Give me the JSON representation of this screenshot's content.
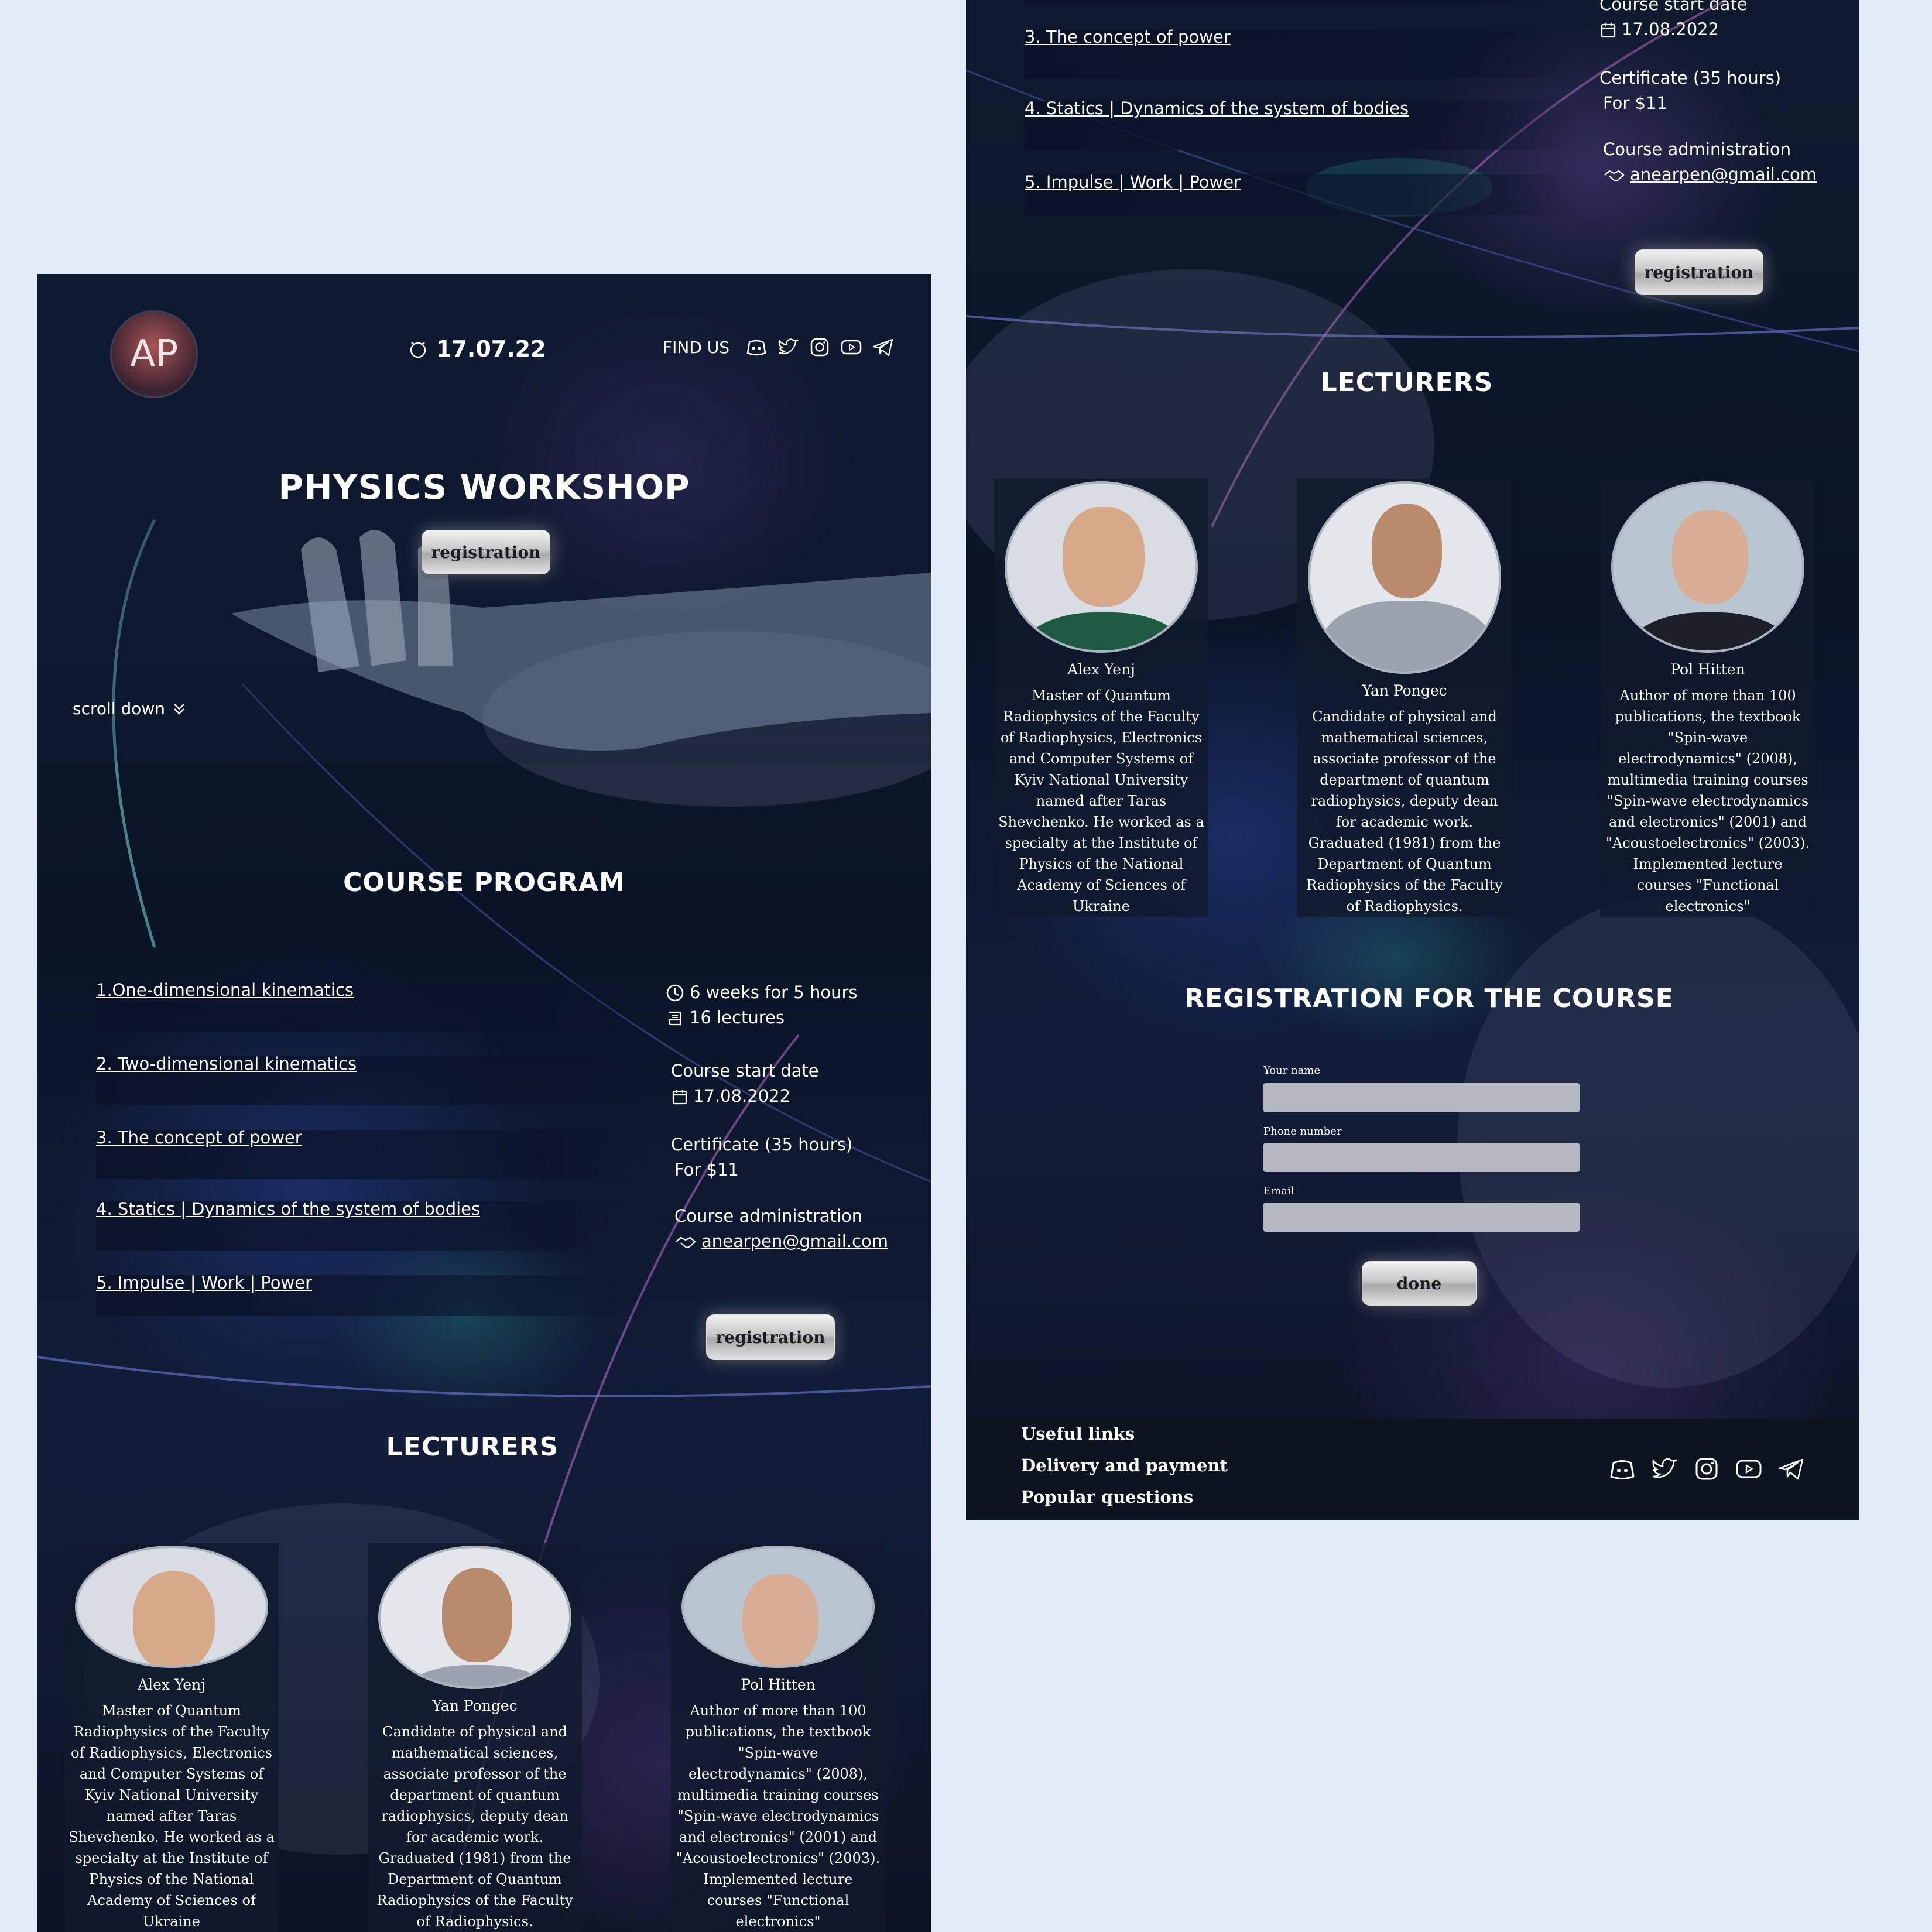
{
  "header": {
    "logo_text": "AP",
    "date": "17.07.22",
    "find_us": "FIND US"
  },
  "hero": {
    "title": "PHYSICS WORKSHOP",
    "register_label": "registration",
    "scroll_label": "scroll down"
  },
  "program": {
    "title": "COURSE PROGRAM",
    "items": [
      {
        "label": "1.One-dimensional kinematics"
      },
      {
        "label": "2. Two-dimensional kinematics"
      },
      {
        "label": "3. The concept of power"
      },
      {
        "label": "4. Statics | Dynamics of the system of bodies"
      },
      {
        "label": "5. Impulse | Work | Power"
      }
    ],
    "duration": "6 weeks for 5 hours",
    "lectures": "16 lectures",
    "start_label": "Course start date",
    "start_date": "17.08.2022",
    "certificate": "Certificate (35 hours)",
    "price": "For $11",
    "admin_label": "Course administration",
    "admin_email": "anearpen@gmail.com",
    "register_label": "registration"
  },
  "lecturers": {
    "title": "LECTURERS",
    "items": [
      {
        "name": "Alex Yenj",
        "bio": "Master of Quantum Radiophysics of the Faculty of Radiophysics, Electronics and Computer Systems of Kyiv National University named after Taras Shevchenko. He worked as a specialty at the Institute of Physics of the National Academy of Sciences of Ukraine",
        "shirt": "#1f5a44",
        "bg": "#d7dde3"
      },
      {
        "name": "Yan Pongec",
        "bio": "Candidate of physical and mathematical sciences, associate professor of the department of quantum radiophysics, deputy dean for academic work. Graduated (1981) from the Department of Quantum Radiophysics of the Faculty of Radiophysics.",
        "shirt": "#9aa3ad",
        "bg": "#e3e6ea"
      },
      {
        "name": "Pol Hitten",
        "bio": "Author of more than 100 publications, the textbook \"Spin-wave electrodynamics\" (2008), multimedia training courses \"Spin-wave electrodynamics and electronics\" (2001) and \"Acoustoelectronics\" (2003). Implemented lecture courses \"Functional electronics\"",
        "shirt": "#1c1f28",
        "bg": "#b9c6d2"
      }
    ]
  },
  "registration": {
    "title": "REGISTRATION FOR THE COURSE",
    "name_label": "Your name",
    "phone_label": "Phone number",
    "email_label": "Email",
    "submit_label": "done"
  },
  "footer": {
    "links": [
      "Useful links",
      "Delivery and payment",
      "Popular questions"
    ]
  },
  "icons": [
    "discord-icon",
    "twitter-icon",
    "instagram-icon",
    "youtube-icon",
    "telegram-icon"
  ]
}
